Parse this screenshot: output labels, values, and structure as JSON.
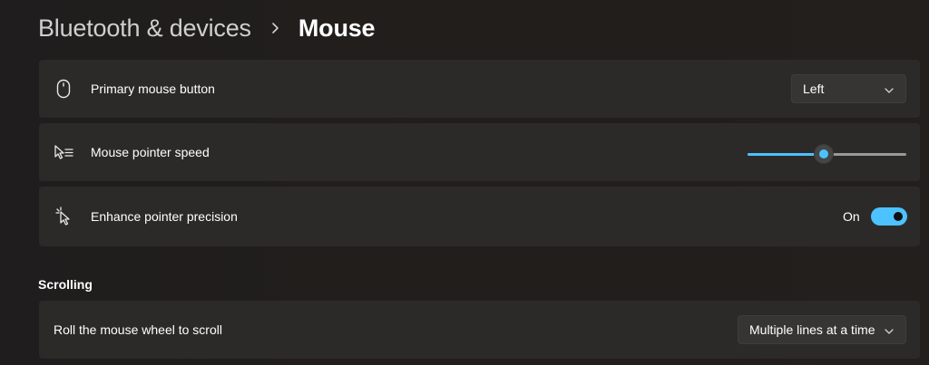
{
  "breadcrumb": {
    "parent": "Bluetooth & devices",
    "separator_icon": "chevron-right-icon",
    "current": "Mouse"
  },
  "settings": {
    "primary_button": {
      "icon": "mouse-icon",
      "label": "Primary mouse button",
      "value": "Left"
    },
    "pointer_speed": {
      "icon": "pointer-speed-icon",
      "label": "Mouse pointer speed",
      "level_fraction": 0.48
    },
    "precision": {
      "icon": "pointer-precision-icon",
      "label": "Enhance pointer precision",
      "state_label": "On",
      "enabled": true
    }
  },
  "scrolling": {
    "heading": "Scrolling",
    "wheel": {
      "label": "Roll the mouse wheel to scroll",
      "value": "Multiple lines at a time"
    }
  },
  "colors": {
    "accent": "#4cc2ff",
    "card": "#2c2a29",
    "background": "#201d1c"
  }
}
